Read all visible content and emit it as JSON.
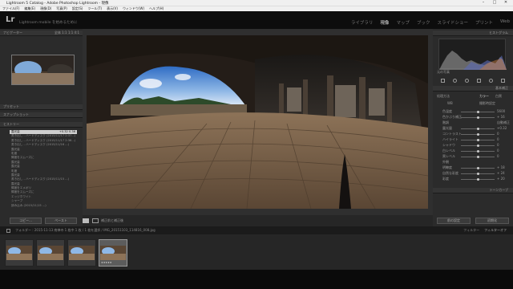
{
  "window": {
    "title": "Lightroom 5 Catalog - Adobe Photoshop Lightroom - 現像",
    "controls": [
      "–",
      "□",
      "✕"
    ]
  },
  "menu": [
    "ファイル(F)",
    "編集(E)",
    "現像(D)",
    "写真(P)",
    "設定(S)",
    "ツール(T)",
    "表示(V)",
    "ウィンドウ(W)",
    "ヘルプ(H)"
  ],
  "identity": {
    "logo": "Lr",
    "message": "Lightroom mobile を始めるために"
  },
  "modules": [
    {
      "label": "ライブラリ",
      "active": false
    },
    {
      "label": "現像",
      "active": true
    },
    {
      "label": "マップ",
      "active": false
    },
    {
      "label": "ブック",
      "active": false
    },
    {
      "label": "スライドショー",
      "active": false
    },
    {
      "label": "プリント",
      "active": false
    },
    {
      "label": "Web",
      "active": false
    }
  ],
  "left": {
    "navigator": {
      "title": "ナビゲーター",
      "modes": "全体 1:1 1:1 4:1"
    },
    "sections": [
      "プリセット",
      "スナップショット",
      "ヒストリー"
    ],
    "history": [
      {
        "label": "露光量",
        "value": "+0.32   0.36",
        "selected": true
      },
      {
        "label": "書き出し - ハードディスク (2015/11/17 2:37...)",
        "value": "",
        "selected": false
      },
      {
        "label": "書き出し - ハードディスク (2015/11/17 2:36...)",
        "value": "",
        "selected": false
      },
      {
        "label": "書き出し - ハードディスク (2015/11/16 ...)",
        "value": "",
        "selected": false
      },
      {
        "label": "露光量",
        "value": "",
        "selected": false
      },
      {
        "label": "彩度",
        "value": "",
        "selected": false
      },
      {
        "label": "輝度をスムーズに",
        "value": "",
        "selected": false
      },
      {
        "label": "露光量",
        "value": "",
        "selected": false
      },
      {
        "label": "露光量",
        "value": "",
        "selected": false
      },
      {
        "label": "彩度",
        "value": "",
        "selected": false
      },
      {
        "label": "露光量",
        "value": "",
        "selected": false
      },
      {
        "label": "書き出し - ハードディスク (2015/11/15 ...)",
        "value": "",
        "selected": false
      },
      {
        "label": "露光量",
        "value": "",
        "selected": false
      },
      {
        "label": "輝度をエメボリ",
        "value": "",
        "selected": false
      },
      {
        "label": "輝度をスムーズに",
        "value": "",
        "selected": false
      },
      {
        "label": "エッジホワイト",
        "value": "",
        "selected": false
      },
      {
        "label": "シャープ",
        "value": "",
        "selected": false
      },
      {
        "label": "読み込み (2015/11/15 ...)",
        "value": "",
        "selected": false
      }
    ],
    "buttons": {
      "copy": "コピー...",
      "paste": "ペースト"
    }
  },
  "toolbar": {
    "label": "補正前と補正後"
  },
  "right": {
    "histogram": {
      "title": "ヒストグラム",
      "meta": "ISO 100   9mm   f/1.8"
    },
    "original": "元の写真",
    "basic": {
      "title": "基本補正",
      "treatment_label": "処理方法",
      "treatment_values": [
        "カラー",
        "白黒"
      ],
      "profile_label": "プロファイル",
      "wb_label": "WB",
      "wb_value": "撮影時設定",
      "rows": [
        {
          "label": "色温度",
          "value": "5600"
        },
        {
          "label": "色かぶり補正",
          "value": "+ 16"
        },
        {
          "label": "階調",
          "value": "自動補正"
        },
        {
          "label": "露光量",
          "value": "+0.32"
        },
        {
          "label": "コントラスト",
          "value": "0"
        },
        {
          "label": "ハイライト",
          "value": "0"
        },
        {
          "label": "シャドウ",
          "value": "0"
        },
        {
          "label": "白レベル",
          "value": "0"
        },
        {
          "label": "黒レベル",
          "value": "0"
        },
        {
          "label": "外観",
          "value": ""
        },
        {
          "label": "明瞭度",
          "value": "+ 18"
        },
        {
          "label": "自然な彩度",
          "value": "+ 24"
        },
        {
          "label": "彩度",
          "value": "+ 20"
        }
      ]
    },
    "tonecurve_title": "トーンカーブ",
    "buttons": {
      "previous": "前の設定",
      "reset": "初期化"
    }
  },
  "filmstrip": {
    "info": "フォルダー : 2015-11-13 南禅寺   1 枚中 1 枚 / 1 枚を選択 / IMG_20151103_114816_008.jpg",
    "filter_label": "フィルター",
    "filter_value": "フィルターオフ",
    "thumbs": [
      {
        "selected": false
      },
      {
        "selected": false
      },
      {
        "selected": false
      },
      {
        "selected": true,
        "stars": "★★★★★"
      }
    ]
  }
}
